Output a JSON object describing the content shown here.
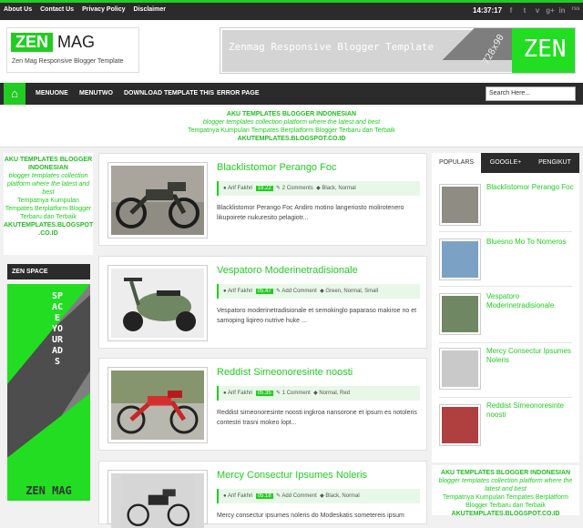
{
  "topbar": {
    "links": [
      "About Us",
      "Contact Us",
      "Privacy Policy",
      "Disclaimer"
    ],
    "clock": "14:37:17",
    "social": [
      "f",
      "t",
      "v",
      "g+",
      "in",
      "rss"
    ]
  },
  "header": {
    "logo_zen": "ZEN",
    "logo_mag": "MAG",
    "tagline": "Zen Mag Responsive Blogger Template",
    "banner_text": "Zenmag Responsive Blogger Template",
    "banner_size": "728x90",
    "banner_zen": "ZEN"
  },
  "nav": {
    "items": [
      "MENUONE",
      "MENUTWO",
      "DOWNLOAD TEMPLATE THIS",
      "ERROR PAGE"
    ],
    "search_value": "Search Here..."
  },
  "notice": {
    "line1": "AKU TEMPLATES BLOGGER INDONESIAN",
    "line2": "blogger templates collection platform where the latest and best",
    "line3": "Tempatnya Kumpulan Tempates Berplatform Blogger Terbaru dan Terbaik",
    "line4": "AKUTEMPLATES.BLOGSPOT.CO.ID"
  },
  "leftad": {
    "line1": "AKU TEMPLATES BLOGGER INDONESIAN",
    "line2": "blogger templates collection platform where the latest and best",
    "line3": "Tempatnya Kumpulan Tempates Berplatform Blogger Terbaru dan Terbaik",
    "line4": "AKUTEMPLATES.BLOGSPOT .CO.ID"
  },
  "zenspace": {
    "heading": "ZEN SPACE",
    "vertical": "SPACE YOUR ADS",
    "footer": "ZEN MAG"
  },
  "posts": [
    {
      "title": "Blacklistomor Perango Foc",
      "author": "Arif Fakhri",
      "date": "19.22",
      "comments": "2 Comments",
      "labels": "Black, Normal",
      "excerpt": "Blacklistomor Perango Foc Andiro motino langeriosto molirotenero likupoirete nukuresito pelagiotr..."
    },
    {
      "title": "Vespatoro Moderinetradisionale",
      "author": "Arif Fakhri",
      "date": "05.47",
      "comments": "Add Comment",
      "labels": "Green, Normal, Small",
      "excerpt": "Vespatoro moderinetradisionale et semokinglo paparaso makiroe no et samoping liqireo nutrive huke ..."
    },
    {
      "title": "Reddist Simeonoresinte noosti",
      "author": "Arif Fakhri",
      "date": "05.35",
      "comments": "1 Comment",
      "labels": "Normal, Red",
      "excerpt": "Reddist simeonoresinte noosti ingkroa nansorone et ipsum es notoleris contestri trasni mokeo lopt..."
    },
    {
      "title": "Mercy Consectur Ipsumes Noleris",
      "author": "Arif Fakhri",
      "date": "05.18",
      "comments": "Add Comment",
      "labels": "Black, Normal",
      "excerpt": "Mercy consectur ipsumes noleris do Modeskatis sometereis ipsum"
    }
  ],
  "tabs": [
    "POPULARS",
    "GOOGLE+",
    "PENGIKUT"
  ],
  "popular": [
    "Blacklistomor Perango Foc",
    "Bluesno Mo To Nomeros",
    "Vespatoro Moderinetradisionale",
    "Mercy Consectur Ipsumes Noleris",
    "Reddist Simeonoresinte noosti"
  ],
  "rightad": {
    "line1": "AKU TEMPLATES BLOGGER INDONESIAN",
    "line2": "blogger templates collection platform where the latest and best",
    "line3": "Tempatnya Kumpulan Tempates Berplatform Blogger Terbaru dan Terbaik",
    "line4": "AKUTEMPLATES.BLOGSPOT.CO.ID"
  },
  "colors": {
    "accent": "#22cc22",
    "dark": "#2b2b2b"
  }
}
